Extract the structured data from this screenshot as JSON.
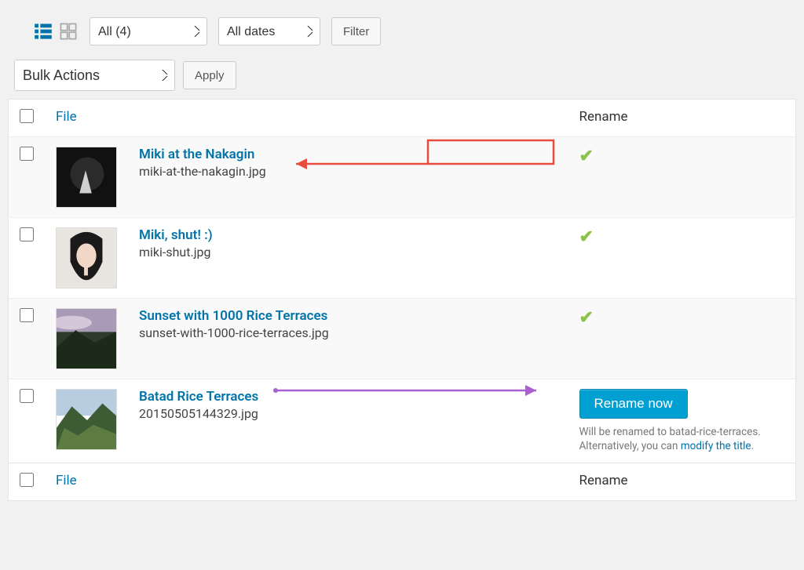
{
  "toolbar": {
    "filter_all_label": "All (4)",
    "filter_dates_label": "All dates",
    "filter_button": "Filter"
  },
  "bulk": {
    "select_label": "Bulk Actions",
    "apply_button": "Apply"
  },
  "columns": {
    "file": "File",
    "rename": "Rename"
  },
  "rows": [
    {
      "title": "Miki at the Nakagin",
      "filename": "miki-at-the-nakagin.jpg",
      "status": "ok"
    },
    {
      "title": "Miki, shut! :)",
      "filename": "miki-shut.jpg",
      "status": "ok"
    },
    {
      "title": "Sunset with 1000 Rice Terraces",
      "filename": "sunset-with-1000-rice-terraces.jpg",
      "status": "ok"
    },
    {
      "title": "Batad Rice Terraces",
      "filename": "20150505144329.jpg",
      "status": "needs_rename"
    }
  ],
  "rename_action": {
    "button": "Rename now",
    "note_prefix": "Will be renamed to batad-rice-terraces. Alternatively, you can ",
    "note_link": "modify the title",
    "note_suffix": "."
  }
}
